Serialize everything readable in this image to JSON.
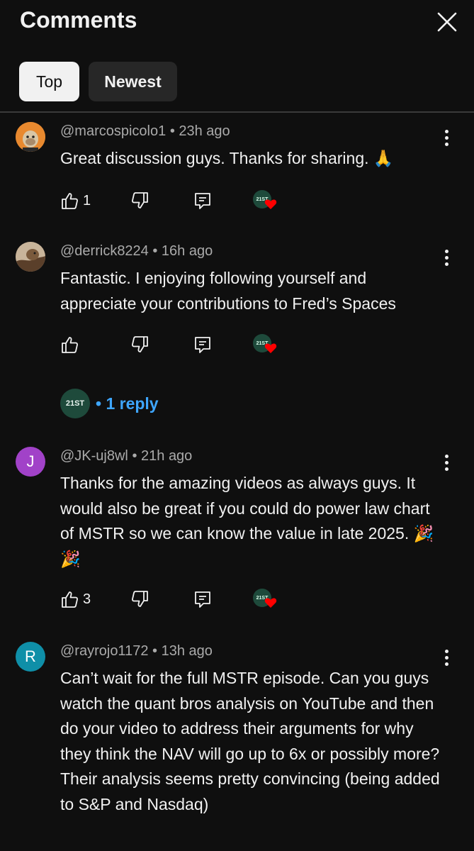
{
  "header": {
    "title": "Comments"
  },
  "tabs": [
    {
      "label": "Top",
      "selected": true
    },
    {
      "label": "Newest",
      "selected": false
    }
  ],
  "channel_avatar_text": "21ST",
  "colors": {
    "background": "#0f0f0f",
    "reply_blue": "#3ea6ff",
    "heart_red": "#ff0000",
    "chip_selected": "#f1f1f1"
  },
  "comments": [
    {
      "author": "@marcospicolo1",
      "time": "• 23h ago",
      "text": "Great discussion guys. Thanks for sharing. 🙏",
      "likes": "1",
      "avatar_letter": "",
      "avatar_color": "#e8892f"
    },
    {
      "author": "@derrick8224",
      "time": "• 16h ago",
      "text": "Fantastic. I enjoying following yourself and appreciate your contributions to Fred’s Spaces",
      "likes": "",
      "avatar_letter": "",
      "avatar_color": "#8a6a4a",
      "replies": "• 1 reply"
    },
    {
      "author": "@JK-uj8wl",
      "time": "• 21h ago",
      "text": "Thanks for the amazing videos as always guys. It would also be great if you could do power law chart of MSTR so we can know the value in late 2025. 🎉🎉",
      "likes": "3",
      "avatar_letter": "J",
      "avatar_color": "#a142c8"
    },
    {
      "author": "@rayrojo1172",
      "time": "• 13h ago",
      "text": "Can’t wait for the full MSTR episode. Can you guys watch the quant bros analysis on YouTube and then do your video to address their arguments for why they think the NAV will go up to 6x or possibly more? Their analysis seems pretty convincing (being added to S&P and Nasdaq)",
      "likes": "",
      "avatar_letter": "R",
      "avatar_color": "#0f8fa8"
    }
  ]
}
